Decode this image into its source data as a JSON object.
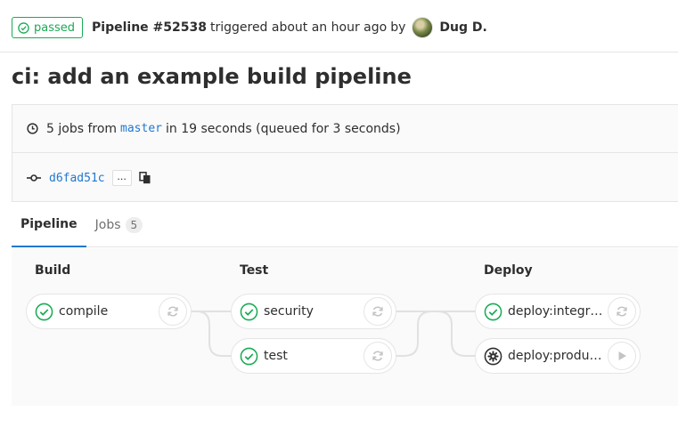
{
  "header": {
    "status_label": "passed",
    "pipeline_label": "Pipeline #52538",
    "triggered_text": "triggered about an hour ago",
    "by_text": "by",
    "user_name": "Dug D."
  },
  "commit": {
    "title": "ci: add an example build pipeline"
  },
  "info": {
    "jobs_text": "5 jobs from",
    "branch": "master",
    "duration_text": "in 19 seconds (queued for 3 seconds)",
    "sha": "d6fad51c",
    "ellipsis_label": "..."
  },
  "tabs": [
    {
      "label": "Pipeline"
    },
    {
      "label": "Jobs",
      "count": "5"
    }
  ],
  "stages": [
    {
      "name": "Build",
      "jobs": [
        {
          "name": "compile",
          "status": "success",
          "action": "retry"
        }
      ]
    },
    {
      "name": "Test",
      "jobs": [
        {
          "name": "security",
          "status": "success",
          "action": "retry"
        },
        {
          "name": "test",
          "status": "success",
          "action": "retry"
        }
      ]
    },
    {
      "name": "Deploy",
      "jobs": [
        {
          "name": "deploy:integration",
          "status": "success",
          "action": "retry"
        },
        {
          "name": "deploy:production",
          "status": "manual",
          "action": "play"
        }
      ]
    }
  ],
  "colors": {
    "success": "#1aaa55",
    "link": "#1f78d1",
    "border": "#e5e5e5",
    "icon_gray": "#c4c4c4",
    "manual": "#2e2e2e"
  },
  "icons": {
    "status": "check-circle-icon",
    "clock": "clock-icon",
    "commit": "commit-icon",
    "copy": "clipboard-icon",
    "retry": "retry-icon",
    "play": "play-icon",
    "manual": "gear-icon"
  }
}
